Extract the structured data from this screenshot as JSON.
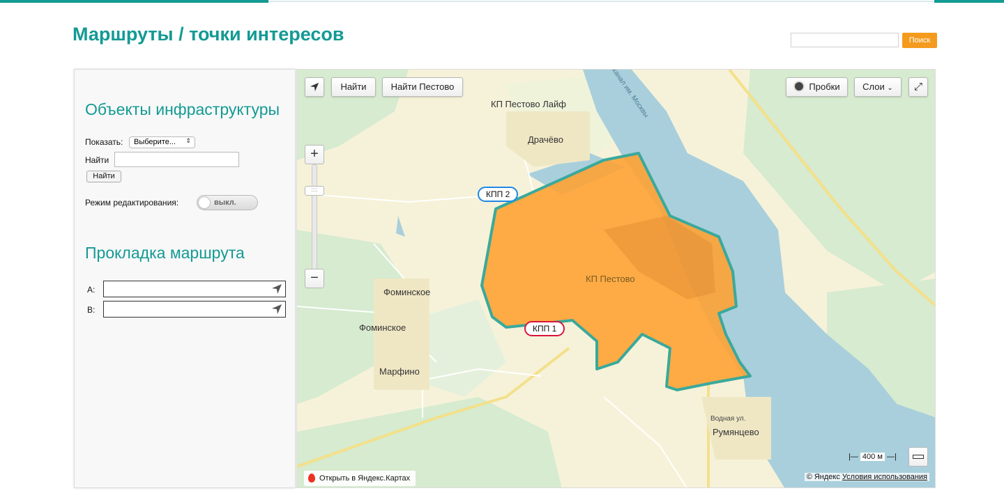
{
  "header": {
    "title": "Маршруты / точки интересов",
    "search_placeholder": "",
    "search_button": "Поиск"
  },
  "sidebar": {
    "infra_heading": "Объекты инфраструктуры",
    "show_label": "Показать:",
    "show_select_value": "Выберите...",
    "find_label": "Найти",
    "find_button": "Найти",
    "edit_mode_label": "Режим редактирования:",
    "edit_mode_toggle": "выкл.",
    "route_heading": "Прокладка маршрута",
    "route_a_label": "A:",
    "route_b_label": "B:"
  },
  "map": {
    "find_button": "Найти",
    "find_pestovo_button": "Найти Пестово",
    "traffic_button": "Пробки",
    "layers_button": "Слои",
    "zoom_in": "+",
    "zoom_out": "−",
    "zoom_handle": "::::",
    "place_labels": {
      "kp_pestovo_life": "КП Пестово Лайф",
      "drachevo": "Драчёво",
      "kp_pestovo": "КП Пестово",
      "fominskoe_1": "Фоминское",
      "fominskoe_2": "Фоминское",
      "marfino": "Марфино",
      "vodnaya": "Водная ул.",
      "rumyantsevo": "Румянцево",
      "canal": "канал им. Москвы"
    },
    "markers": {
      "kpp2": "КПП 2",
      "kpp1": "КПП 1"
    },
    "open_in_yandex": "Открыть в Яндекс.Картах",
    "copyright": "© Яндекс",
    "terms": "Условия использования",
    "scale": "400 м",
    "colors": {
      "polygon_fill": "#ffa030",
      "polygon_stroke": "#3aa99b",
      "water": "#a9cfdc",
      "forest": "#d6ebcf",
      "land": "#f6f2d9",
      "accent": "#139a94",
      "search_button": "#f49b1e"
    }
  }
}
